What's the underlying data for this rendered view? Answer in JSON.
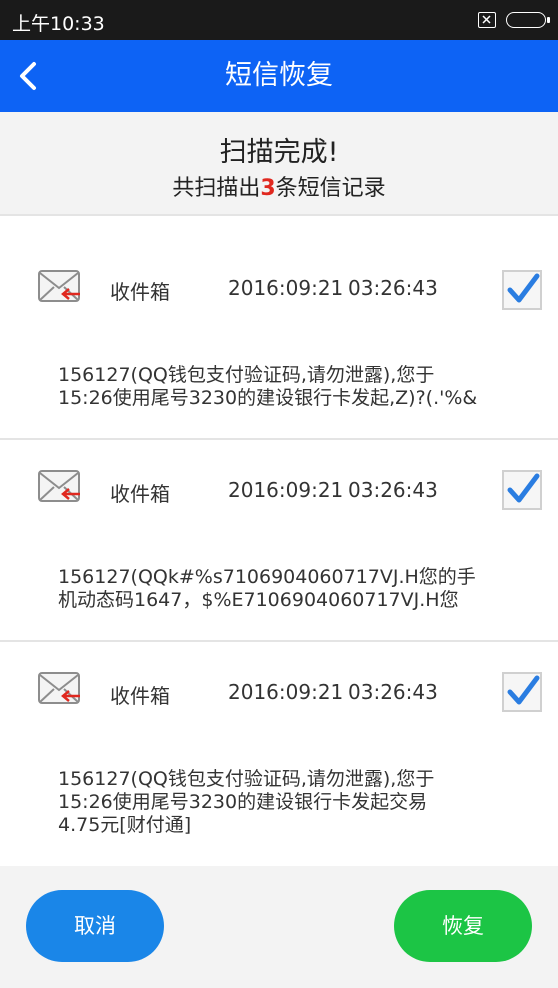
{
  "status_bar": {
    "time": "上午10:33"
  },
  "app_bar": {
    "title": "短信恢复"
  },
  "summary": {
    "title": "扫描完成!",
    "prefix": "共扫描出",
    "count": "3",
    "suffix": "条短信记录"
  },
  "messages": [
    {
      "folder": "收件箱",
      "date": "2016:09:21",
      "time": "03:26:43",
      "checked": true,
      "body": "156127(QQ钱包支付验证码,请勿泄露),您于\n15:26使用尾号3230的建设银行卡发起,Z)?(.'%&"
    },
    {
      "folder": "收件箱",
      "date": "2016:09:21",
      "time": "03:26:43",
      "checked": true,
      "body": "156127(QQk#%s7106904060717VJ.H您的手\n机动态码1647，$%E7106904060717VJ.H您"
    },
    {
      "folder": "收件箱",
      "date": "2016:09:21",
      "time": "03:26:43",
      "checked": true,
      "body": "156127(QQ钱包支付验证码,请勿泄露),您于\n15:26使用尾号3230的建设银行卡发起交易\n4.75元[财付通]"
    }
  ],
  "buttons": {
    "cancel": "取消",
    "restore": "恢复"
  },
  "colors": {
    "app_bar": "#0d63f5",
    "cancel": "#1a86e8",
    "restore": "#1cc545",
    "count": "#e0281f",
    "check": "#2a7de1"
  },
  "icons": {
    "back": "chevron-left-icon",
    "mail": "envelope-arrow-icon",
    "check": "checkmark-icon",
    "sim": "sim-card-icon",
    "battery": "battery-icon"
  }
}
